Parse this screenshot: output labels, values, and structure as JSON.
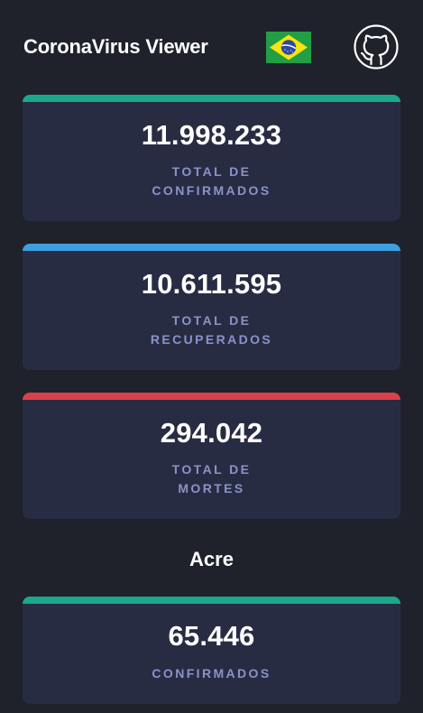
{
  "header": {
    "title": "CoronaVirus Viewer",
    "flag_icon": "brazil-flag-icon",
    "github_icon": "github-icon"
  },
  "colors": {
    "background": "#1f222b",
    "card": "#282c43",
    "label": "#8a93c7",
    "confirmed": "#1aa88a",
    "recovered": "#3d9ee0",
    "deaths": "#d9414a"
  },
  "totals": {
    "confirmed": {
      "value": "11.998.233",
      "label": "TOTAL DE\nCONFIRMADOS"
    },
    "recovered": {
      "value": "10.611.595",
      "label": "TOTAL DE\nRECUPERADOS"
    },
    "deaths": {
      "value": "294.042",
      "label": "TOTAL DE\nMORTES"
    }
  },
  "state": {
    "name": "Acre",
    "confirmed": {
      "value": "65.446",
      "label": "CONFIRMADOS"
    }
  }
}
